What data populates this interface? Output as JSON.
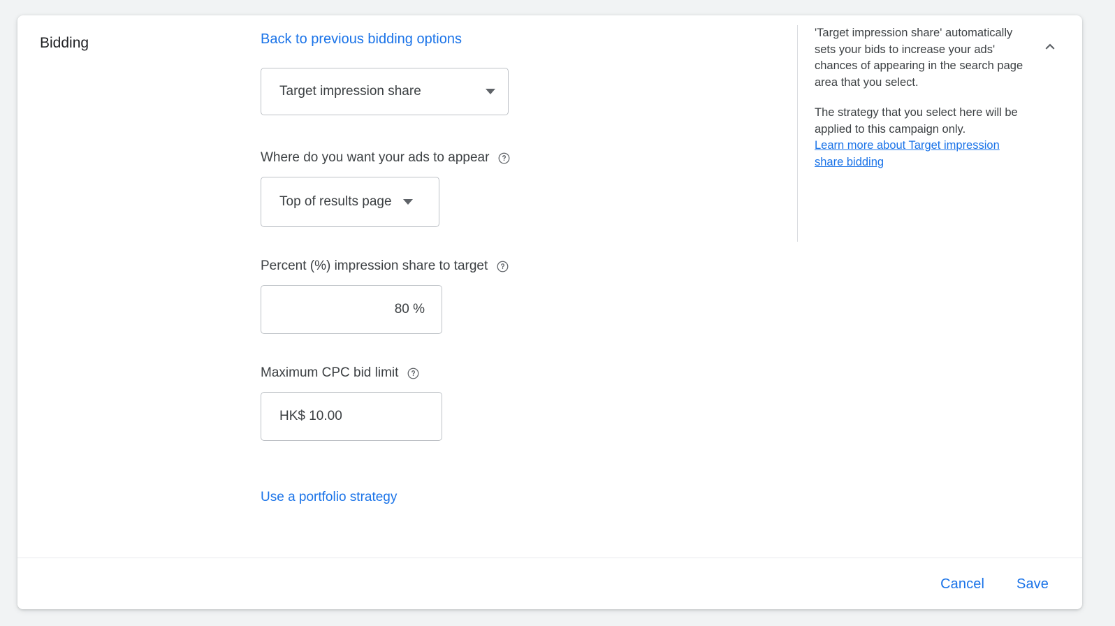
{
  "card": {
    "section_title": "Bidding",
    "collapse_icon": "chevron-up-icon"
  },
  "form": {
    "back_link": "Back to previous bidding options",
    "strategy_select": {
      "value": "Target impression share",
      "caret_icon": "chevron-down-icon"
    },
    "location_field": {
      "label": "Where do you want your ads to appear",
      "help_icon": "help-circle-icon",
      "value": "Top of results page",
      "caret_icon": "chevron-down-icon"
    },
    "percent_field": {
      "label": "Percent (%) impression share to target",
      "help_icon": "help-circle-icon",
      "value": "80 %",
      "placeholder": "80 %"
    },
    "cpc_field": {
      "label": "Maximum CPC bid limit",
      "help_icon": "help-circle-icon",
      "value": "HK$ 10.00",
      "placeholder": "HK$ 10.00"
    },
    "portfolio_link": "Use a portfolio strategy"
  },
  "side_panel": {
    "paragraph_1": "'Target impression share' automatically sets your bids to increase your ads' chances of appearing in the search page area that you select.",
    "paragraph_2": "The strategy that you select here will be applied to this campaign only.",
    "learn_more_link": "Learn more about Target impression share bidding"
  },
  "footer": {
    "cancel_label": "Cancel",
    "save_label": "Save"
  },
  "colors": {
    "accent_blue": "#1a73e8",
    "text_primary": "#202124",
    "text_secondary": "#3c4043",
    "border": "#bdc1c6",
    "divider": "#dadce0",
    "page_background": "#f1f3f4",
    "card_background": "#ffffff"
  }
}
